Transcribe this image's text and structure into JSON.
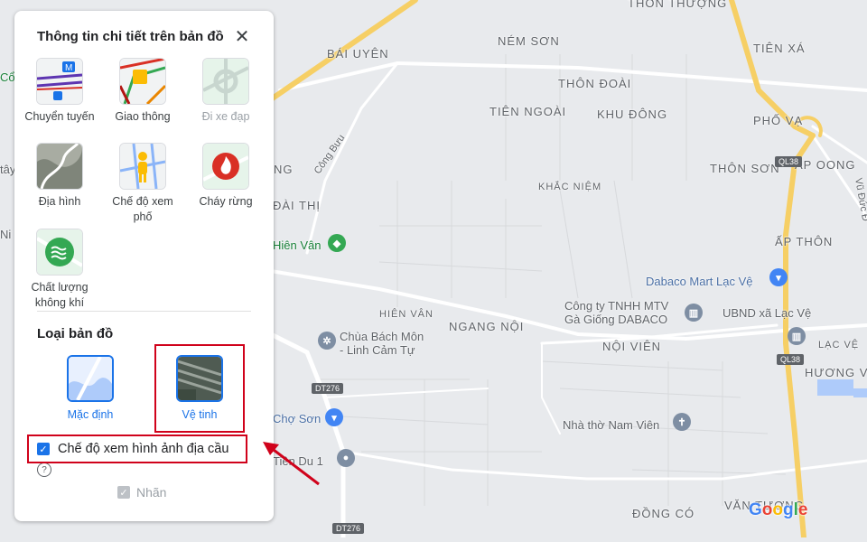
{
  "panel": {
    "title": "Thông tin chi tiết trên bản đồ",
    "details": [
      {
        "label": "Chuyển tuyến",
        "icon": "transit-icon",
        "disabled": false
      },
      {
        "label": "Giao thông",
        "icon": "traffic-icon",
        "disabled": false
      },
      {
        "label": "Đi xe đạp",
        "icon": "biking-icon",
        "disabled": true
      },
      {
        "label": "Địa hình",
        "icon": "terrain-icon",
        "disabled": false
      },
      {
        "label": "Chế độ xem phố",
        "icon": "street-view-icon",
        "disabled": false
      },
      {
        "label": "Cháy rừng",
        "icon": "wildfire-icon",
        "disabled": false
      },
      {
        "label": "Chất lượng không khí",
        "icon": "air-quality-icon",
        "disabled": false
      }
    ],
    "map_type_heading": "Loại bản đồ",
    "map_types": [
      {
        "label": "Mặc định",
        "icon": "default-map-icon"
      },
      {
        "label": "Vệ tinh",
        "icon": "satellite-map-icon"
      }
    ],
    "globe_label": "Chế độ xem hình ảnh địa cầu",
    "globe_checked": true,
    "labels_label": "Nhãn",
    "labels_checked": true,
    "help_glyph": "?"
  },
  "map": {
    "places": [
      "THÔN THƯỢNG",
      "NÉM SƠN",
      "TIÊN XÁ",
      "BÁI UYÊN",
      "THÔN ĐOÀI",
      "TIÊN NGOÀI",
      "KHU ĐÔNG",
      "PHỐ VẠ",
      "THÔN SƠN",
      "ẤP OONG",
      "KHẮC NIỆM",
      "ĐÀI THỊ",
      "ẤP THÔN",
      "HIÊN VÂN",
      "NGANG NỘI",
      "NỘI VIÊN",
      "LẠC VỆ",
      "HƯƠNG V",
      "ĐỒNG CÓ",
      "VĂN TƯƠNG",
      "NG"
    ],
    "pois": [
      "Hiên Vân",
      "Dabaco Mart Lạc Vệ",
      "Công ty TNHH MTV\nGà Giống DABACO",
      "UBND xã Lạc Vệ",
      "Chùa Bách Môn\n- Linh Cảm Tự",
      "Chợ Sơn",
      "Nhà thờ Nam Viên",
      "Tiên Du 1"
    ],
    "roads": [
      "Công Bưu",
      "Vũ Đức Đ"
    ],
    "shields": [
      "QL38",
      "QL38",
      "DT276",
      "DT276"
    ],
    "edge_text": [
      "Cổ",
      "tây",
      "Ni",
      "Ng"
    ],
    "logo": "Google"
  },
  "colors": {
    "accent": "#1a73e8",
    "highlight": "#d0021b",
    "road_yellow": "#f6cf65",
    "map_bg": "#e8eaed"
  }
}
